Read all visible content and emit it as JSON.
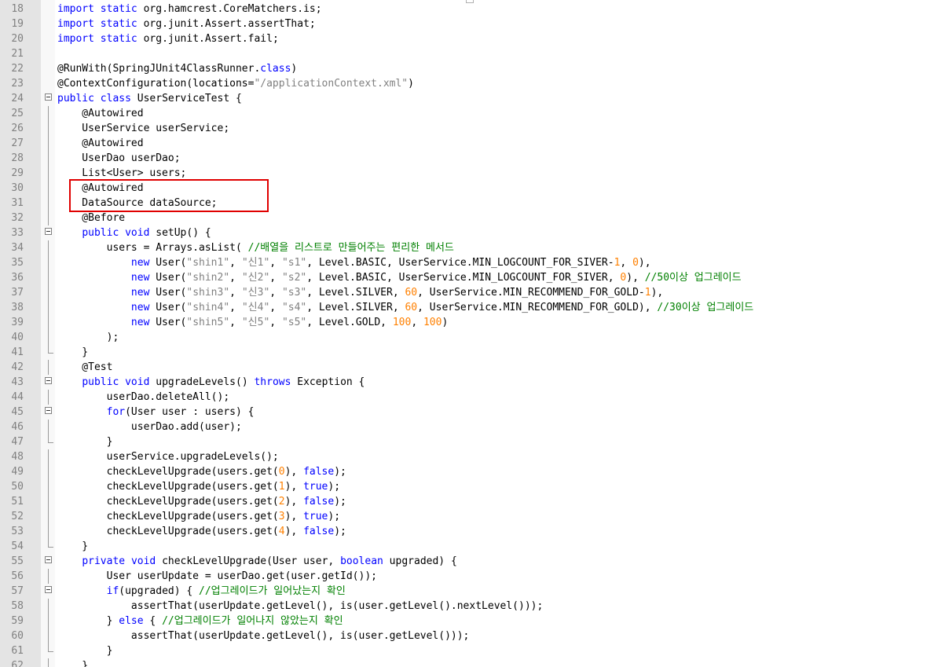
{
  "editor": {
    "colors": {
      "keyword": "#0000ff",
      "string": "#808080",
      "number": "#ff8000",
      "comment": "#008000",
      "plain": "#000000",
      "highlight": "#e00000"
    },
    "lines": [
      {
        "n": "18",
        "fold": "",
        "tokens": [
          {
            "t": "import",
            "c": "kw"
          },
          {
            "t": " "
          },
          {
            "t": "static",
            "c": "kw"
          },
          {
            "t": " org.hamcrest.CoreMatchers.is;"
          }
        ]
      },
      {
        "n": "19",
        "fold": "",
        "tokens": [
          {
            "t": "import",
            "c": "kw"
          },
          {
            "t": " "
          },
          {
            "t": "static",
            "c": "kw"
          },
          {
            "t": " org.junit.Assert.assertThat;"
          }
        ]
      },
      {
        "n": "20",
        "fold": "",
        "tokens": [
          {
            "t": "import",
            "c": "kw"
          },
          {
            "t": " "
          },
          {
            "t": "static",
            "c": "kw"
          },
          {
            "t": " org.junit.Assert.fail;"
          }
        ]
      },
      {
        "n": "21",
        "fold": "",
        "tokens": []
      },
      {
        "n": "22",
        "fold": "",
        "tokens": [
          {
            "t": "@RunWith(SpringJUnit4ClassRunner."
          },
          {
            "t": "class",
            "c": "kw"
          },
          {
            "t": ")"
          }
        ]
      },
      {
        "n": "23",
        "fold": "",
        "tokens": [
          {
            "t": "@ContextConfiguration(locations="
          },
          {
            "t": "\"/applicationContext.xml\"",
            "c": "str"
          },
          {
            "t": ")"
          }
        ]
      },
      {
        "n": "24",
        "fold": "start",
        "tokens": [
          {
            "t": "public",
            "c": "kw"
          },
          {
            "t": " "
          },
          {
            "t": "class",
            "c": "kw"
          },
          {
            "t": " UserServiceTest {"
          }
        ]
      },
      {
        "n": "25",
        "fold": "line",
        "tokens": [
          {
            "t": "    @Autowired"
          }
        ]
      },
      {
        "n": "26",
        "fold": "line",
        "tokens": [
          {
            "t": "    UserService userService;"
          }
        ]
      },
      {
        "n": "27",
        "fold": "line",
        "tokens": [
          {
            "t": "    @Autowired"
          }
        ]
      },
      {
        "n": "28",
        "fold": "line",
        "tokens": [
          {
            "t": "    UserDao userDao;"
          }
        ]
      },
      {
        "n": "29",
        "fold": "line",
        "tokens": [
          {
            "t": "    List<User> users;"
          }
        ]
      },
      {
        "n": "30",
        "fold": "line",
        "tokens": [
          {
            "t": "    @Autowired"
          }
        ]
      },
      {
        "n": "31",
        "fold": "line",
        "tokens": [
          {
            "t": "    DataSource dataSource;"
          }
        ]
      },
      {
        "n": "32",
        "fold": "line",
        "tokens": [
          {
            "t": "    @Before"
          }
        ]
      },
      {
        "n": "33",
        "fold": "start",
        "tokens": [
          {
            "t": "    "
          },
          {
            "t": "public",
            "c": "kw"
          },
          {
            "t": " "
          },
          {
            "t": "void",
            "c": "kw"
          },
          {
            "t": " setUp() {"
          }
        ]
      },
      {
        "n": "34",
        "fold": "line",
        "tokens": [
          {
            "t": "        users = Arrays.asList( "
          },
          {
            "t": "//배열을 리스트로 만들어주는 편리한 메서드",
            "c": "cm"
          }
        ]
      },
      {
        "n": "35",
        "fold": "line",
        "tokens": [
          {
            "t": "            "
          },
          {
            "t": "new",
            "c": "kw"
          },
          {
            "t": " User("
          },
          {
            "t": "\"shin1\"",
            "c": "str"
          },
          {
            "t": ", "
          },
          {
            "t": "\"신1\"",
            "c": "str"
          },
          {
            "t": ", "
          },
          {
            "t": "\"s1\"",
            "c": "str"
          },
          {
            "t": ", Level.BASIC, UserService.MIN_LOGCOUNT_FOR_SIVER-"
          },
          {
            "t": "1",
            "c": "num"
          },
          {
            "t": ", "
          },
          {
            "t": "0",
            "c": "num"
          },
          {
            "t": "),"
          }
        ]
      },
      {
        "n": "36",
        "fold": "line",
        "tokens": [
          {
            "t": "            "
          },
          {
            "t": "new",
            "c": "kw"
          },
          {
            "t": " User("
          },
          {
            "t": "\"shin2\"",
            "c": "str"
          },
          {
            "t": ", "
          },
          {
            "t": "\"신2\"",
            "c": "str"
          },
          {
            "t": ", "
          },
          {
            "t": "\"s2\"",
            "c": "str"
          },
          {
            "t": ", Level.BASIC, UserService.MIN_LOGCOUNT_FOR_SIVER, "
          },
          {
            "t": "0",
            "c": "num"
          },
          {
            "t": "), "
          },
          {
            "t": "//50이상 업그레이드",
            "c": "cm"
          }
        ]
      },
      {
        "n": "37",
        "fold": "line",
        "tokens": [
          {
            "t": "            "
          },
          {
            "t": "new",
            "c": "kw"
          },
          {
            "t": " User("
          },
          {
            "t": "\"shin3\"",
            "c": "str"
          },
          {
            "t": ", "
          },
          {
            "t": "\"신3\"",
            "c": "str"
          },
          {
            "t": ", "
          },
          {
            "t": "\"s3\"",
            "c": "str"
          },
          {
            "t": ", Level.SILVER, "
          },
          {
            "t": "60",
            "c": "num"
          },
          {
            "t": ", UserService.MIN_RECOMMEND_FOR_GOLD-"
          },
          {
            "t": "1",
            "c": "num"
          },
          {
            "t": "),"
          }
        ]
      },
      {
        "n": "38",
        "fold": "line",
        "tokens": [
          {
            "t": "            "
          },
          {
            "t": "new",
            "c": "kw"
          },
          {
            "t": " User("
          },
          {
            "t": "\"shin4\"",
            "c": "str"
          },
          {
            "t": ", "
          },
          {
            "t": "\"신4\"",
            "c": "str"
          },
          {
            "t": ", "
          },
          {
            "t": "\"s4\"",
            "c": "str"
          },
          {
            "t": ", Level.SILVER, "
          },
          {
            "t": "60",
            "c": "num"
          },
          {
            "t": ", UserService.MIN_RECOMMEND_FOR_GOLD), "
          },
          {
            "t": "//30이상 업그레이드",
            "c": "cm"
          }
        ]
      },
      {
        "n": "39",
        "fold": "line",
        "tokens": [
          {
            "t": "            "
          },
          {
            "t": "new",
            "c": "kw"
          },
          {
            "t": " User("
          },
          {
            "t": "\"shin5\"",
            "c": "str"
          },
          {
            "t": ", "
          },
          {
            "t": "\"신5\"",
            "c": "str"
          },
          {
            "t": ", "
          },
          {
            "t": "\"s5\"",
            "c": "str"
          },
          {
            "t": ", Level.GOLD, "
          },
          {
            "t": "100",
            "c": "num"
          },
          {
            "t": ", "
          },
          {
            "t": "100",
            "c": "num"
          },
          {
            "t": ")"
          }
        ]
      },
      {
        "n": "40",
        "fold": "line",
        "tokens": [
          {
            "t": "        );"
          }
        ]
      },
      {
        "n": "41",
        "fold": "end",
        "tokens": [
          {
            "t": "    }"
          }
        ]
      },
      {
        "n": "42",
        "fold": "line",
        "tokens": [
          {
            "t": "    @Test"
          }
        ]
      },
      {
        "n": "43",
        "fold": "start",
        "tokens": [
          {
            "t": "    "
          },
          {
            "t": "public",
            "c": "kw"
          },
          {
            "t": " "
          },
          {
            "t": "void",
            "c": "kw"
          },
          {
            "t": " upgradeLevels() "
          },
          {
            "t": "throws",
            "c": "kw"
          },
          {
            "t": " Exception {"
          }
        ]
      },
      {
        "n": "44",
        "fold": "line",
        "tokens": [
          {
            "t": "        userDao.deleteAll();"
          }
        ]
      },
      {
        "n": "45",
        "fold": "start",
        "tokens": [
          {
            "t": "        "
          },
          {
            "t": "for",
            "c": "kw"
          },
          {
            "t": "(User user : users) {"
          }
        ]
      },
      {
        "n": "46",
        "fold": "line",
        "tokens": [
          {
            "t": "            userDao.add(user);"
          }
        ]
      },
      {
        "n": "47",
        "fold": "end",
        "tokens": [
          {
            "t": "        }"
          }
        ]
      },
      {
        "n": "48",
        "fold": "line",
        "tokens": [
          {
            "t": "        userService.upgradeLevels();"
          }
        ]
      },
      {
        "n": "49",
        "fold": "line",
        "tokens": [
          {
            "t": "        checkLevelUpgrade(users.get("
          },
          {
            "t": "0",
            "c": "num"
          },
          {
            "t": "), "
          },
          {
            "t": "false",
            "c": "kw"
          },
          {
            "t": ");"
          }
        ]
      },
      {
        "n": "50",
        "fold": "line",
        "tokens": [
          {
            "t": "        checkLevelUpgrade(users.get("
          },
          {
            "t": "1",
            "c": "num"
          },
          {
            "t": "), "
          },
          {
            "t": "true",
            "c": "kw"
          },
          {
            "t": ");"
          }
        ]
      },
      {
        "n": "51",
        "fold": "line",
        "tokens": [
          {
            "t": "        checkLevelUpgrade(users.get("
          },
          {
            "t": "2",
            "c": "num"
          },
          {
            "t": "), "
          },
          {
            "t": "false",
            "c": "kw"
          },
          {
            "t": ");"
          }
        ]
      },
      {
        "n": "52",
        "fold": "line",
        "tokens": [
          {
            "t": "        checkLevelUpgrade(users.get("
          },
          {
            "t": "3",
            "c": "num"
          },
          {
            "t": "), "
          },
          {
            "t": "true",
            "c": "kw"
          },
          {
            "t": ");"
          }
        ]
      },
      {
        "n": "53",
        "fold": "line",
        "tokens": [
          {
            "t": "        checkLevelUpgrade(users.get("
          },
          {
            "t": "4",
            "c": "num"
          },
          {
            "t": "), "
          },
          {
            "t": "false",
            "c": "kw"
          },
          {
            "t": ");"
          }
        ]
      },
      {
        "n": "54",
        "fold": "end",
        "tokens": [
          {
            "t": "    }"
          }
        ]
      },
      {
        "n": "55",
        "fold": "start",
        "tokens": [
          {
            "t": "    "
          },
          {
            "t": "private",
            "c": "kw"
          },
          {
            "t": " "
          },
          {
            "t": "void",
            "c": "kw"
          },
          {
            "t": " checkLevelUpgrade(User user, "
          },
          {
            "t": "boolean",
            "c": "kw"
          },
          {
            "t": " upgraded) {"
          }
        ]
      },
      {
        "n": "56",
        "fold": "line",
        "tokens": [
          {
            "t": "        User userUpdate = userDao.get(user.getId());"
          }
        ]
      },
      {
        "n": "57",
        "fold": "start",
        "tokens": [
          {
            "t": "        "
          },
          {
            "t": "if",
            "c": "kw"
          },
          {
            "t": "(upgraded) { "
          },
          {
            "t": "//업그레이드가 일어났는지 확인",
            "c": "cm"
          }
        ]
      },
      {
        "n": "58",
        "fold": "line",
        "tokens": [
          {
            "t": "            assertThat(userUpdate.getLevel(), is(user.getLevel().nextLevel()));"
          }
        ]
      },
      {
        "n": "59",
        "fold": "line",
        "tokens": [
          {
            "t": "        } "
          },
          {
            "t": "else",
            "c": "kw"
          },
          {
            "t": " { "
          },
          {
            "t": "//업그레이드가 일어나지 않았는지 확인",
            "c": "cm"
          }
        ]
      },
      {
        "n": "60",
        "fold": "line",
        "tokens": [
          {
            "t": "            assertThat(userUpdate.getLevel(), is(user.getLevel()));"
          }
        ]
      },
      {
        "n": "61",
        "fold": "end",
        "tokens": [
          {
            "t": "        }"
          }
        ]
      },
      {
        "n": "62",
        "fold": "line",
        "tokens": [
          {
            "t": "    }"
          }
        ]
      }
    ]
  }
}
